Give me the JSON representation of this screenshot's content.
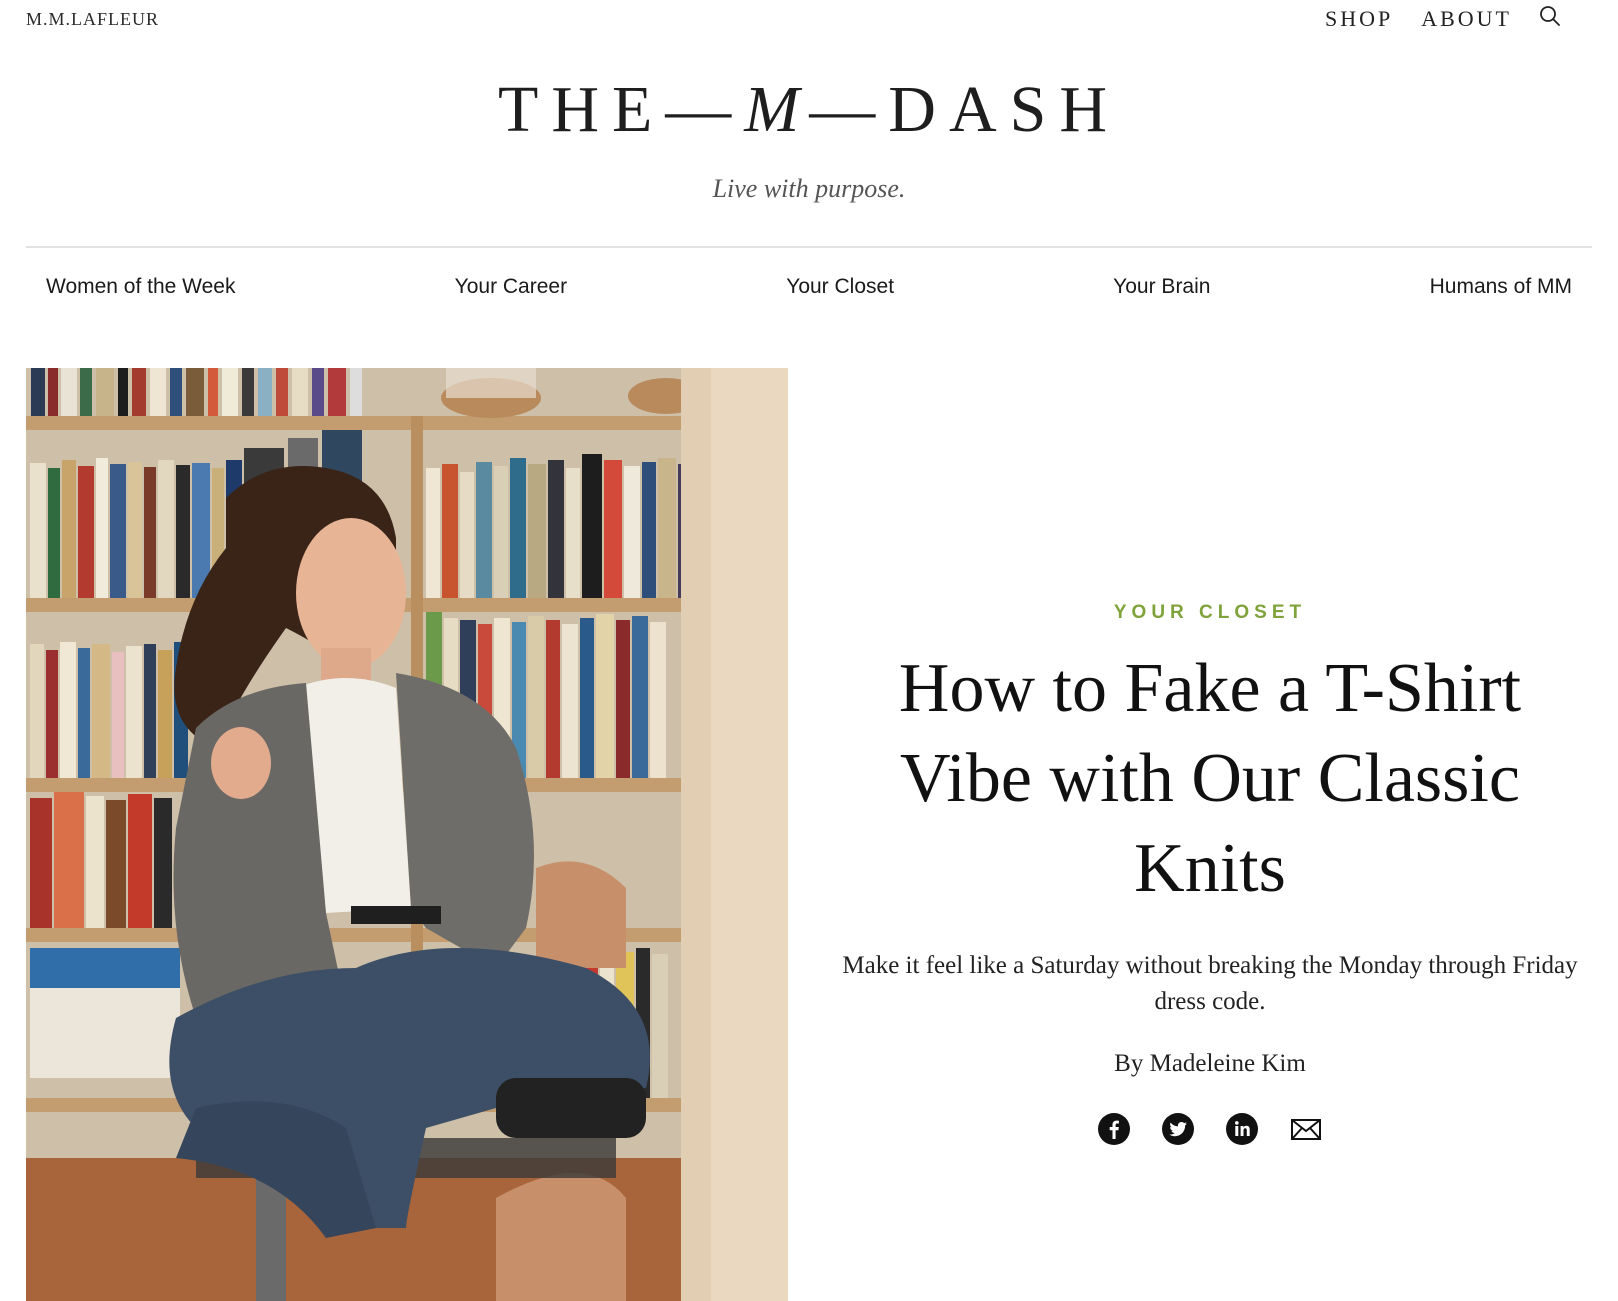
{
  "header": {
    "brand": "M.M.LAFLEUR",
    "nav": {
      "shop": "SHOP",
      "about": "ABOUT"
    },
    "search_icon": "search-icon"
  },
  "masthead": {
    "logo_left": "THE—",
    "logo_mid": "M",
    "logo_right": "—DASH",
    "tagline": "Live with purpose."
  },
  "categories": [
    "Women of the Week",
    "Your Career",
    "Your Closet",
    "Your Brain",
    "Humans of MM"
  ],
  "article": {
    "category": "YOUR CLOSET",
    "title": "How to Fake a T-Shirt Vibe with Our Classic Knits",
    "dek": "Make it feel like a Saturday without breaking the Monday through Friday dress code.",
    "byline": "By Madeleine Kim",
    "share_icons": [
      "facebook-icon",
      "twitter-icon",
      "linkedin-icon",
      "email-icon"
    ]
  },
  "colors": {
    "accent_green": "#7fa33a",
    "text": "#1b1b1b",
    "rule": "#e2e2e2"
  }
}
